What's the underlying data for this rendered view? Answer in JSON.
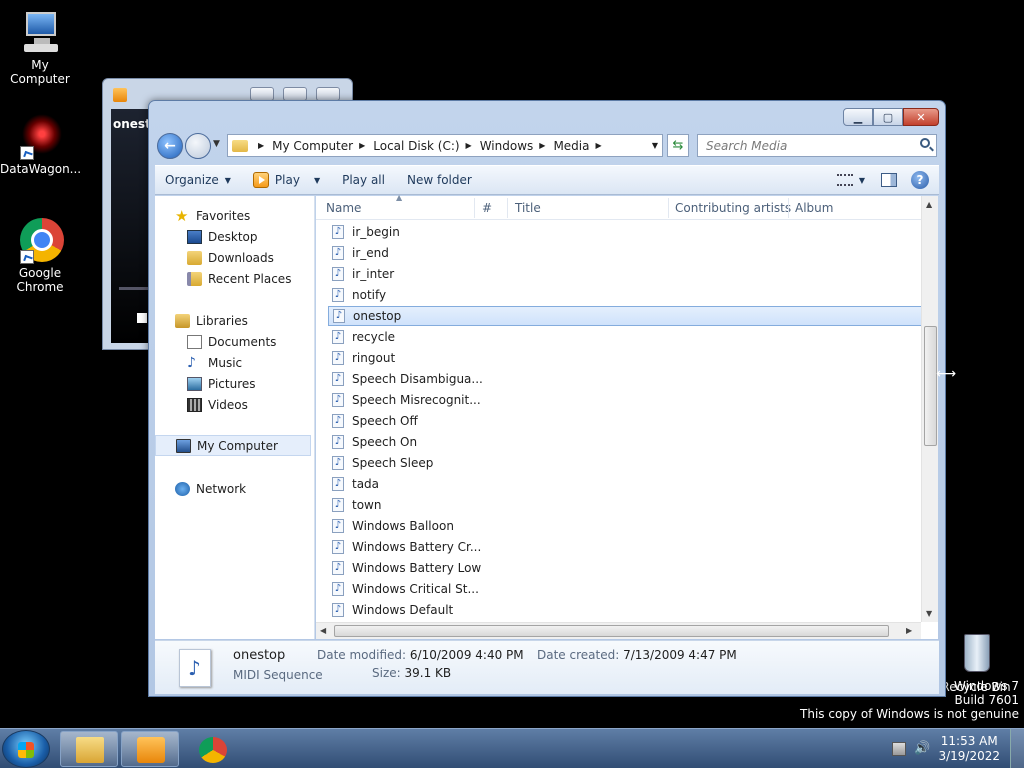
{
  "desktop": {
    "icons": [
      {
        "label": "My Computer"
      },
      {
        "label": "DataWagon..."
      },
      {
        "label": "Google Chrome"
      },
      {
        "label": "Recycle Bin"
      }
    ],
    "watermark": {
      "line1": "Windows 7",
      "line2": "Build 7601",
      "line3": "This copy of Windows is not genuine"
    }
  },
  "media_player": {
    "title": "onest"
  },
  "explorer": {
    "address": {
      "segments": [
        "My Computer",
        "Local Disk (C:)",
        "Windows",
        "Media"
      ]
    },
    "search": {
      "placeholder": "Search Media"
    },
    "toolbar": {
      "organize": "Organize",
      "play": "Play",
      "play_all": "Play all",
      "new_folder": "New folder"
    },
    "nav_pane": {
      "favorites": "Favorites",
      "desktop": "Desktop",
      "downloads": "Downloads",
      "recent_places": "Recent Places",
      "libraries": "Libraries",
      "documents": "Documents",
      "music": "Music",
      "pictures": "Pictures",
      "videos": "Videos",
      "my_computer": "My Computer",
      "network": "Network"
    },
    "columns": {
      "name": "Name",
      "number": "#",
      "title": "Title",
      "artists": "Contributing artists",
      "album": "Album"
    },
    "files": [
      "ir_begin",
      "ir_end",
      "ir_inter",
      "notify",
      "onestop",
      "recycle",
      "ringout",
      "Speech Disambigua...",
      "Speech Misrecognit...",
      "Speech Off",
      "Speech On",
      "Speech Sleep",
      "tada",
      "town",
      "Windows Balloon",
      "Windows Battery Cr...",
      "Windows Battery Low",
      "Windows Critical St...",
      "Windows Default"
    ],
    "selected_file": "onestop",
    "details": {
      "name": "onestop",
      "type": "MIDI Sequence",
      "modified_label": "Date modified:",
      "modified_value": "6/10/2009 4:40 PM",
      "created_label": "Date created:",
      "created_value": "7/13/2009 4:47 PM",
      "size_label": "Size:",
      "size_value": "39.1 KB"
    }
  },
  "taskbar": {
    "time": "11:53 AM",
    "date": "3/19/2022"
  }
}
